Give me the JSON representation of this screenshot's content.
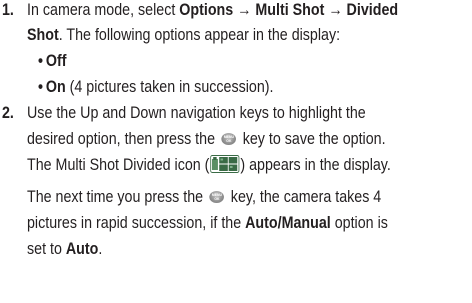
{
  "step1": {
    "number": "1.",
    "line1_pre": "In camera mode, select ",
    "path": "Options → Multi Shot → Divided",
    "line2_bold": "Shot",
    "line2_rest": ". The following options appear in the display:",
    "bullets": [
      {
        "label": "Off",
        "rest": ""
      },
      {
        "label": "On",
        "rest": " (4 pictures taken in succession)."
      }
    ]
  },
  "step2": {
    "number": "2.",
    "line1": "Use the Up and Down navigation keys to highlight the",
    "line2_pre": "desired option, then press the ",
    "line2_post": " key to save the option.",
    "line3_pre": "The Multi Shot Divided icon (",
    "line3_post": ") appears in the display.",
    "line4_pre": "The next time you press the ",
    "line4_post": " key, the camera takes 4",
    "line5": "pictures in rapid succession, if the ",
    "line5_bold": "Auto/Manual",
    "line5_post": " option is",
    "line6_pre": "set to ",
    "line6_bold": "Auto",
    "line6_post": "."
  },
  "icons": {
    "menu_key": {
      "name": "menu-ok-key-icon",
      "text_top": "MENU",
      "text_bottom": "OK",
      "color": "#8f8f8f"
    },
    "multishot": {
      "name": "multi-shot-divided-icon",
      "color": "#3a6b46"
    }
  }
}
